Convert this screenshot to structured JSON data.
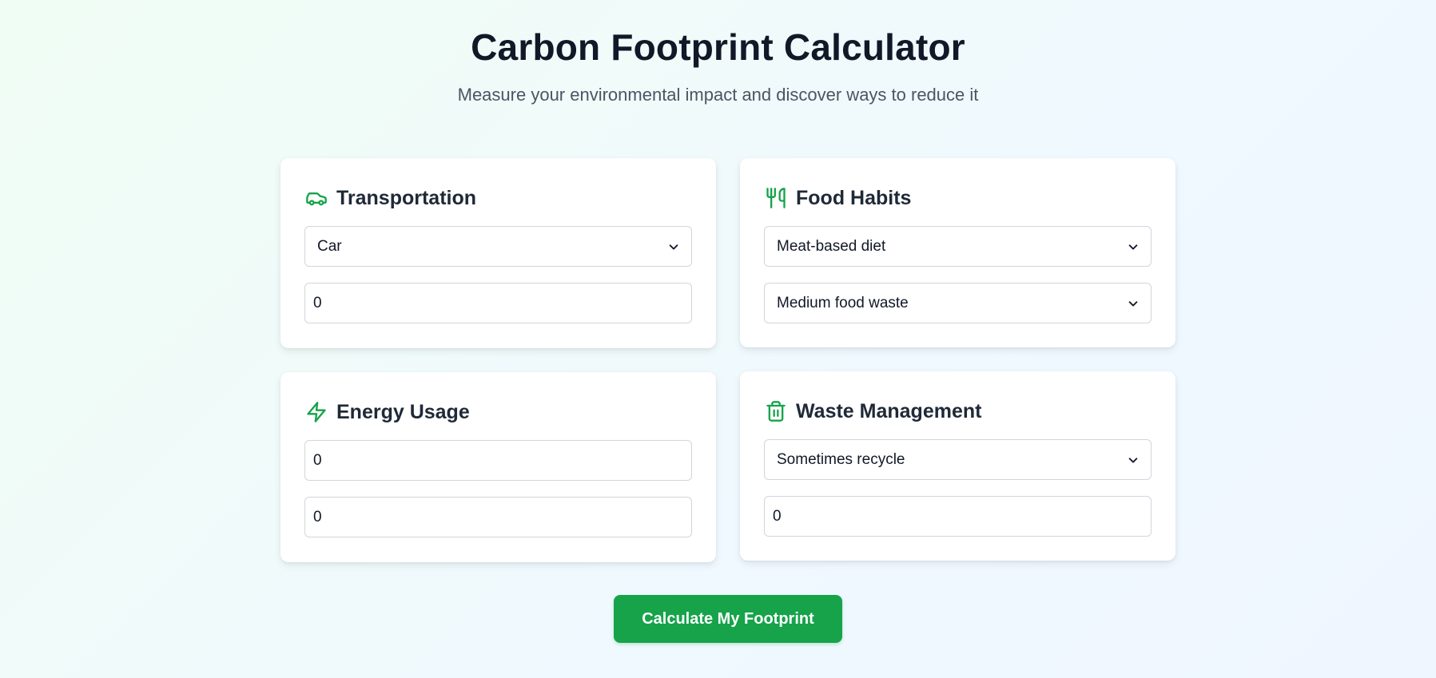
{
  "header": {
    "title": "Carbon Footprint Calculator",
    "subtitle": "Measure your environmental impact and discover ways to reduce it"
  },
  "colors": {
    "accent": "#16a34a",
    "title": "#111827",
    "subtitle": "#4b5563"
  },
  "cards": {
    "transportation": {
      "title": "Transportation",
      "icon": "car-icon",
      "mode_select": "Car",
      "distance_value": "0"
    },
    "food": {
      "title": "Food Habits",
      "icon": "utensils-icon",
      "diet_select": "Meat-based diet",
      "waste_select": "Medium food waste"
    },
    "energy": {
      "title": "Energy Usage",
      "icon": "lightning-icon",
      "electricity_value": "0",
      "gas_value": "0"
    },
    "waste": {
      "title": "Waste Management",
      "icon": "trash-icon",
      "recycle_select": "Sometimes recycle",
      "waste_value": "0"
    }
  },
  "actions": {
    "calculate_label": "Calculate My Footprint"
  }
}
